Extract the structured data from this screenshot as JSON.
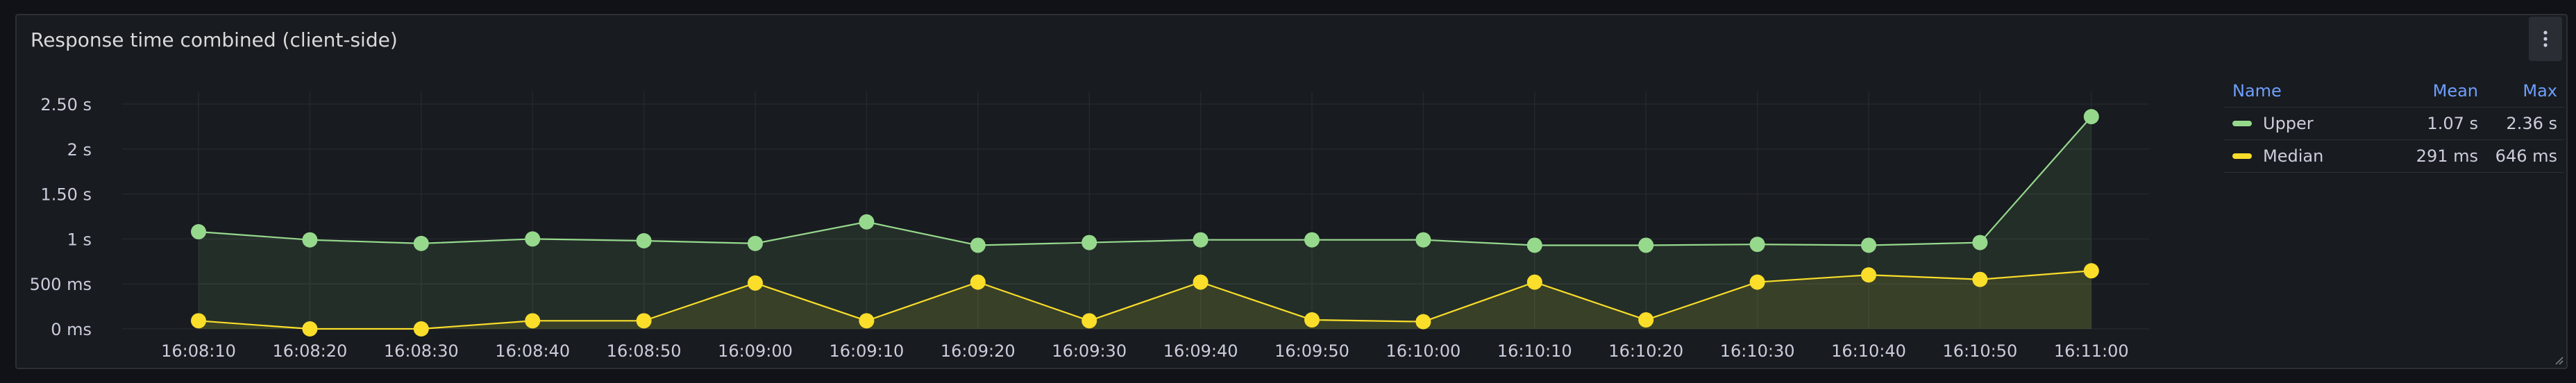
{
  "panel": {
    "title": "Response time combined (client-side)",
    "menu_icon": "vertical-ellipsis-icon"
  },
  "legend": {
    "headers": {
      "name": "Name",
      "mean": "Mean",
      "max": "Max"
    },
    "rows": [
      {
        "name": "Upper",
        "mean": "1.07 s",
        "max": "2.36 s",
        "color": "#96d98d"
      },
      {
        "name": "Median",
        "mean": "291 ms",
        "max": "646 ms",
        "color": "#fade2a"
      }
    ]
  },
  "chart_data": {
    "type": "line",
    "title": "Response time combined (client-side)",
    "xlabel": "",
    "ylabel": "",
    "categories": [
      "16:08:10",
      "16:08:20",
      "16:08:30",
      "16:08:40",
      "16:08:50",
      "16:09:00",
      "16:09:10",
      "16:09:20",
      "16:09:30",
      "16:09:40",
      "16:09:50",
      "16:10:00",
      "16:10:10",
      "16:10:20",
      "16:10:30",
      "16:10:40",
      "16:10:50",
      "16:11:00"
    ],
    "y_ticks": [
      {
        "value": 0,
        "label": "0 ms"
      },
      {
        "value": 0.5,
        "label": "500 ms"
      },
      {
        "value": 1,
        "label": "1 s"
      },
      {
        "value": 1.5,
        "label": "1.50 s"
      },
      {
        "value": 2,
        "label": "2 s"
      },
      {
        "value": 2.5,
        "label": "2.50 s"
      }
    ],
    "ylim": [
      0,
      2.5
    ],
    "grid": true,
    "legend_position": "right",
    "series": [
      {
        "name": "Upper",
        "color": "#96d98d",
        "values": [
          1.08,
          0.99,
          0.95,
          1.0,
          0.98,
          0.95,
          1.19,
          0.93,
          0.96,
          0.99,
          0.99,
          0.99,
          0.93,
          0.93,
          0.94,
          0.93,
          0.96,
          2.36
        ]
      },
      {
        "name": "Median",
        "color": "#fade2a",
        "values": [
          0.09,
          0.0,
          0.0,
          0.09,
          0.09,
          0.51,
          0.09,
          0.52,
          0.09,
          0.52,
          0.1,
          0.08,
          0.52,
          0.1,
          0.52,
          0.6,
          0.55,
          0.646
        ]
      }
    ]
  }
}
